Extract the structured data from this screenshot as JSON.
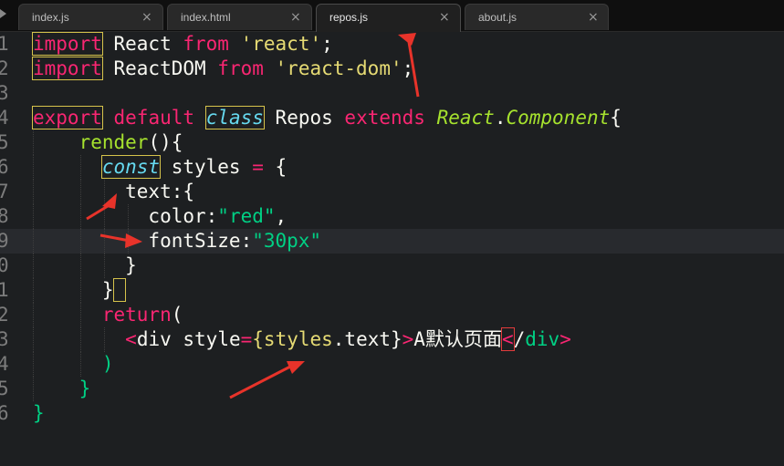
{
  "tabs": [
    {
      "label": "index.js",
      "close": "×",
      "active": false
    },
    {
      "label": "index.html",
      "close": "×",
      "active": false
    },
    {
      "label": "repos.js",
      "close": "×",
      "active": true
    },
    {
      "label": "about.js",
      "close": "×",
      "active": false
    }
  ],
  "editor": {
    "current_line": 9,
    "lines": [
      {
        "num": "1",
        "tokens": [
          {
            "t": "import",
            "c": "kw box"
          },
          {
            "t": " React ",
            "c": ""
          },
          {
            "t": "from",
            "c": "kw"
          },
          {
            "t": " ",
            "c": ""
          },
          {
            "t": "'react'",
            "c": "str"
          },
          {
            "t": ";",
            "c": ""
          }
        ]
      },
      {
        "num": "2",
        "tokens": [
          {
            "t": "import",
            "c": "kw box"
          },
          {
            "t": " ReactDOM ",
            "c": ""
          },
          {
            "t": "from",
            "c": "kw"
          },
          {
            "t": " ",
            "c": ""
          },
          {
            "t": "'react-dom'",
            "c": "str"
          },
          {
            "t": ";",
            "c": ""
          }
        ]
      },
      {
        "num": "3",
        "tokens": []
      },
      {
        "num": "4",
        "tokens": [
          {
            "t": "export",
            "c": "kw box"
          },
          {
            "t": " ",
            "c": ""
          },
          {
            "t": "default",
            "c": "kw"
          },
          {
            "t": " ",
            "c": ""
          },
          {
            "t": "class",
            "c": "box-cls"
          },
          {
            "t": " Repos ",
            "c": ""
          },
          {
            "t": "extends",
            "c": "ext"
          },
          {
            "t": " ",
            "c": ""
          },
          {
            "t": "React",
            "c": "cls"
          },
          {
            "t": ".",
            "c": ""
          },
          {
            "t": "Component",
            "c": "cls"
          },
          {
            "t": "{",
            "c": ""
          }
        ]
      },
      {
        "num": "5",
        "tokens": [
          {
            "t": "    ",
            "c": ""
          },
          {
            "t": "render",
            "c": "fn"
          },
          {
            "t": "(){",
            "c": ""
          }
        ]
      },
      {
        "num": "6",
        "tokens": [
          {
            "t": "      ",
            "c": ""
          },
          {
            "t": "const",
            "c": "box-cls"
          },
          {
            "t": " styles ",
            "c": ""
          },
          {
            "t": "=",
            "c": "kw"
          },
          {
            "t": " {",
            "c": ""
          }
        ]
      },
      {
        "num": "7",
        "tokens": [
          {
            "t": "        text:{",
            "c": ""
          }
        ]
      },
      {
        "num": "8",
        "tokens": [
          {
            "t": "          color:",
            "c": ""
          },
          {
            "t": "\"red\"",
            "c": "str2"
          },
          {
            "t": ",",
            "c": ""
          }
        ]
      },
      {
        "num": "9",
        "tokens": [
          {
            "t": "          fontSize:",
            "c": ""
          },
          {
            "t": "\"30px\"",
            "c": "str2"
          }
        ]
      },
      {
        "num": "0",
        "tokens": [
          {
            "t": "        }",
            "c": ""
          }
        ]
      },
      {
        "num": "1",
        "tokens": [
          {
            "t": "      }",
            "c": ""
          },
          {
            "t": " ",
            "c": "box"
          }
        ]
      },
      {
        "num": "2",
        "tokens": [
          {
            "t": "      ",
            "c": ""
          },
          {
            "t": "return",
            "c": "kw"
          },
          {
            "t": "(",
            "c": ""
          }
        ]
      },
      {
        "num": "3",
        "tokens": [
          {
            "t": "        ",
            "c": ""
          },
          {
            "t": "<",
            "c": "jsx"
          },
          {
            "t": "div ",
            "c": ""
          },
          {
            "t": "style",
            "c": ""
          },
          {
            "t": "=",
            "c": "kw"
          },
          {
            "t": "{",
            "c": "str"
          },
          {
            "t": "styles",
            "c": "str"
          },
          {
            "t": ".text}",
            "c": ""
          },
          {
            "t": ">",
            "c": "jsx"
          },
          {
            "t": "A默认页面",
            "c": ""
          },
          {
            "t": "<",
            "c": "jsx box-red"
          },
          {
            "t": "/",
            "c": ""
          },
          {
            "t": "div",
            "c": "str2"
          },
          {
            "t": ">",
            "c": "jsx"
          }
        ]
      },
      {
        "num": "4",
        "tokens": [
          {
            "t": "      ",
            "c": ""
          },
          {
            "t": ")",
            "c": "str2"
          }
        ]
      },
      {
        "num": "5",
        "tokens": [
          {
            "t": "    ",
            "c": ""
          },
          {
            "t": "}",
            "c": "str2"
          }
        ]
      },
      {
        "num": "6",
        "tokens": [
          {
            "t": "}",
            "c": "str2"
          }
        ]
      }
    ]
  },
  "colors": {
    "background": "#1d1f21",
    "keyword": "#f92672",
    "string": "#e6db74",
    "function": "#a6e22e",
    "annotation_arrow": "#e8332a"
  }
}
